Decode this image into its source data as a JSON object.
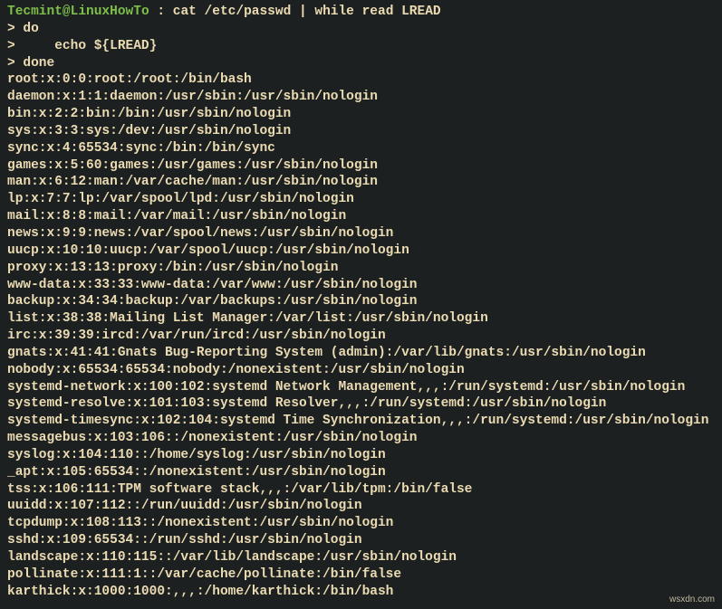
{
  "prompt": {
    "user": "Tecmint",
    "at": "@",
    "host": "LinuxHowTo",
    "separator": " : "
  },
  "command_lines": [
    "cat /etc/passwd | while read LREAD",
    "> do",
    ">     echo ${LREAD}",
    "> done"
  ],
  "output_lines": [
    "root:x:0:0:root:/root:/bin/bash",
    "daemon:x:1:1:daemon:/usr/sbin:/usr/sbin/nologin",
    "bin:x:2:2:bin:/bin:/usr/sbin/nologin",
    "sys:x:3:3:sys:/dev:/usr/sbin/nologin",
    "sync:x:4:65534:sync:/bin:/bin/sync",
    "games:x:5:60:games:/usr/games:/usr/sbin/nologin",
    "man:x:6:12:man:/var/cache/man:/usr/sbin/nologin",
    "lp:x:7:7:lp:/var/spool/lpd:/usr/sbin/nologin",
    "mail:x:8:8:mail:/var/mail:/usr/sbin/nologin",
    "news:x:9:9:news:/var/spool/news:/usr/sbin/nologin",
    "uucp:x:10:10:uucp:/var/spool/uucp:/usr/sbin/nologin",
    "proxy:x:13:13:proxy:/bin:/usr/sbin/nologin",
    "www-data:x:33:33:www-data:/var/www:/usr/sbin/nologin",
    "backup:x:34:34:backup:/var/backups:/usr/sbin/nologin",
    "list:x:38:38:Mailing List Manager:/var/list:/usr/sbin/nologin",
    "irc:x:39:39:ircd:/var/run/ircd:/usr/sbin/nologin",
    "gnats:x:41:41:Gnats Bug-Reporting System (admin):/var/lib/gnats:/usr/sbin/nologin",
    "nobody:x:65534:65534:nobody:/nonexistent:/usr/sbin/nologin",
    "systemd-network:x:100:102:systemd Network Management,,,:/run/systemd:/usr/sbin/nologin",
    "systemd-resolve:x:101:103:systemd Resolver,,,:/run/systemd:/usr/sbin/nologin",
    "systemd-timesync:x:102:104:systemd Time Synchronization,,,:/run/systemd:/usr/sbin/nologin",
    "messagebus:x:103:106::/nonexistent:/usr/sbin/nologin",
    "syslog:x:104:110::/home/syslog:/usr/sbin/nologin",
    "_apt:x:105:65534::/nonexistent:/usr/sbin/nologin",
    "tss:x:106:111:TPM software stack,,,:/var/lib/tpm:/bin/false",
    "uuidd:x:107:112::/run/uuidd:/usr/sbin/nologin",
    "tcpdump:x:108:113::/nonexistent:/usr/sbin/nologin",
    "sshd:x:109:65534::/run/sshd:/usr/sbin/nologin",
    "landscape:x:110:115::/var/lib/landscape:/usr/sbin/nologin",
    "pollinate:x:111:1::/var/cache/pollinate:/bin/false",
    "karthick:x:1000:1000:,,,:/home/karthick:/bin/bash"
  ],
  "watermark": "wsxdn.com"
}
